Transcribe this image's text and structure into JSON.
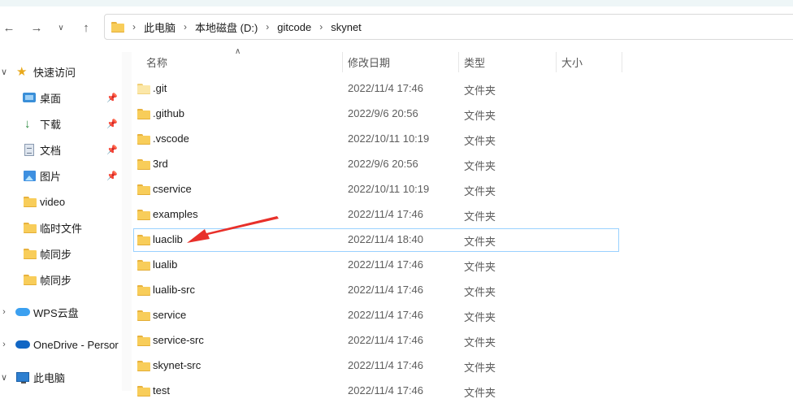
{
  "navigation": {
    "back_icon": "arrow-left-icon",
    "forward_icon": "arrow-right-icon",
    "recent_icon": "chevron-down-icon",
    "up_icon": "arrow-up-icon"
  },
  "address_bar": {
    "breadcrumbs": [
      "此电脑",
      "本地磁盘 (D:)",
      "gitcode",
      "skynet"
    ]
  },
  "sidebar": {
    "quick_access": "快速访问",
    "pinned": [
      {
        "label": "桌面",
        "icon": "desktop-icon"
      },
      {
        "label": "下载",
        "icon": "download-icon"
      },
      {
        "label": "文档",
        "icon": "document-icon"
      },
      {
        "label": "图片",
        "icon": "pictures-icon"
      }
    ],
    "folders": [
      "video",
      "临时文件",
      "帧同步",
      "帧同步"
    ],
    "wps": "WPS云盘",
    "onedrive": "OneDrive - Persor",
    "this_pc": "此电脑"
  },
  "columns": {
    "name": "名称",
    "modified": "修改日期",
    "type": "类型",
    "size": "大小"
  },
  "files": [
    {
      "name": ".git",
      "date": "2022/11/4 17:46",
      "type": "文件夹",
      "hidden": true
    },
    {
      "name": ".github",
      "date": "2022/9/6 20:56",
      "type": "文件夹"
    },
    {
      "name": ".vscode",
      "date": "2022/10/11 10:19",
      "type": "文件夹"
    },
    {
      "name": "3rd",
      "date": "2022/9/6 20:56",
      "type": "文件夹"
    },
    {
      "name": "cservice",
      "date": "2022/10/11 10:19",
      "type": "文件夹"
    },
    {
      "name": "examples",
      "date": "2022/11/4 17:46",
      "type": "文件夹"
    },
    {
      "name": "luaclib",
      "date": "2022/11/4 18:40",
      "type": "文件夹",
      "selected": true
    },
    {
      "name": "lualib",
      "date": "2022/11/4 17:46",
      "type": "文件夹"
    },
    {
      "name": "lualib-src",
      "date": "2022/11/4 17:46",
      "type": "文件夹"
    },
    {
      "name": "service",
      "date": "2022/11/4 17:46",
      "type": "文件夹"
    },
    {
      "name": "service-src",
      "date": "2022/11/4 17:46",
      "type": "文件夹"
    },
    {
      "name": "skynet-src",
      "date": "2022/11/4 17:46",
      "type": "文件夹"
    },
    {
      "name": "test",
      "date": "2022/11/4 17:46",
      "type": "文件夹"
    }
  ],
  "annotation": {
    "color": "#e8302a",
    "icon": "red-arrow-annotation"
  }
}
